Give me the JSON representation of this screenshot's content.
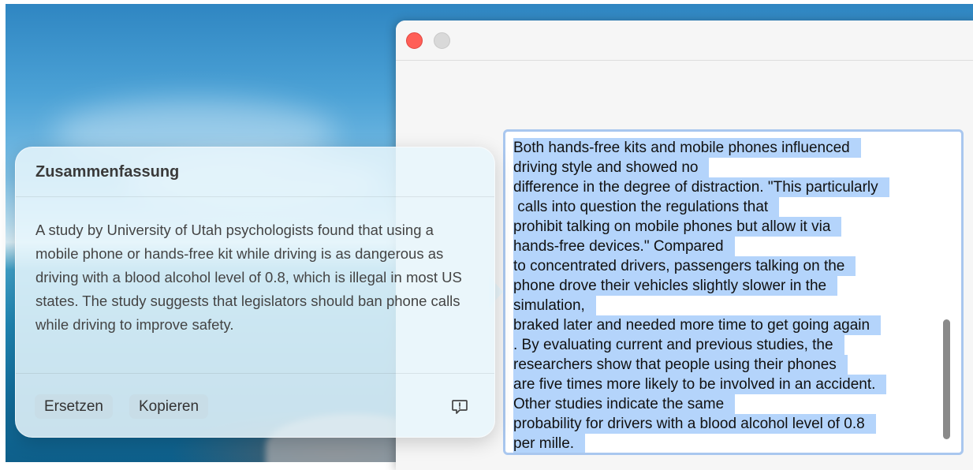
{
  "window": {
    "textarea_lines": [
      "Both hands-free kits and mobile phones influenced",
      "driving style and showed no",
      "difference in the degree of distraction. \"This particularly",
      " calls into question the regulations that",
      "prohibit talking on mobile phones but allow it via",
      "hands-free devices.\" Compared",
      "to concentrated drivers, passengers talking on the",
      "phone drove their vehicles slightly slower in the",
      "simulation,",
      "braked later and needed more time to get going again",
      ". By evaluating current and previous studies, the",
      "researchers show that people using their phones",
      "are five times more likely to be involved in an accident.",
      "Other studies indicate the same",
      "probability for drivers with a blood alcohol level of 0.8",
      "per mille."
    ],
    "selection_color": "#b4d4fb"
  },
  "popover": {
    "title": "Zusammenfassung",
    "summary": "A study by University of Utah psychologists found that using a mobile phone or hands-free kit while driving is as dangerous as driving with a blood alcohol level of 0.8, which is illegal in most US states. The study suggests that legislators should ban phone calls while driving to improve safety.",
    "replace_label": "Ersetzen",
    "copy_label": "Kopieren",
    "feedback_icon": "feedback-icon"
  }
}
